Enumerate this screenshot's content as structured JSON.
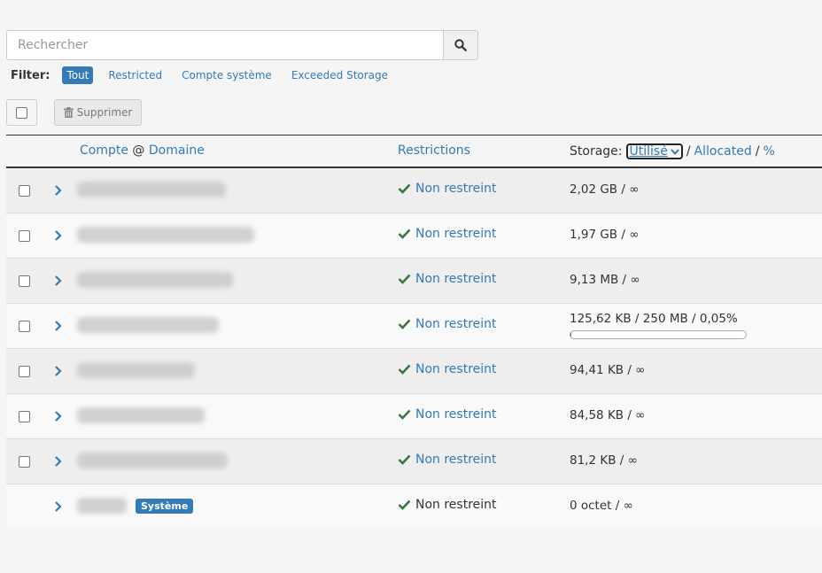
{
  "search": {
    "placeholder": "Rechercher"
  },
  "filter": {
    "label": "Filter:",
    "items": [
      "Tout",
      "Restricted",
      "Compte système",
      "Exceeded Storage"
    ],
    "active": "Tout"
  },
  "toolbar": {
    "delete_label": "Supprimer"
  },
  "table": {
    "headers": {
      "account": "Compte",
      "at": "@",
      "domain": "Domaine",
      "restrictions": "Restrictions",
      "storage_prefix": "Storage:",
      "storage_select": "Utilisé",
      "slash1": "/",
      "allocated": "Allocated",
      "slash2": "/",
      "percent": "%"
    },
    "rows": [
      {
        "restriction": "Non restreint",
        "storage": "2,02 GB / ∞"
      },
      {
        "restriction": "Non restreint",
        "storage": "1,97 GB / ∞"
      },
      {
        "restriction": "Non restreint",
        "storage": "9,13 MB / ∞"
      },
      {
        "restriction": "Non restreint",
        "storage": "125,62 KB / 250 MB / 0,05%",
        "usage_fraction": 0.0005
      },
      {
        "restriction": "Non restreint",
        "storage": "94,41 KB / ∞"
      },
      {
        "restriction": "Non restreint",
        "storage": "84,58 KB / ∞"
      },
      {
        "restriction": "Non restreint",
        "storage": "81,2 KB / ∞"
      },
      {
        "restriction": "Non restreint",
        "storage": "0 octet / ∞",
        "badge": "Système"
      }
    ]
  },
  "colors": {
    "accent": "#337ab7",
    "success": "#3c763d"
  }
}
